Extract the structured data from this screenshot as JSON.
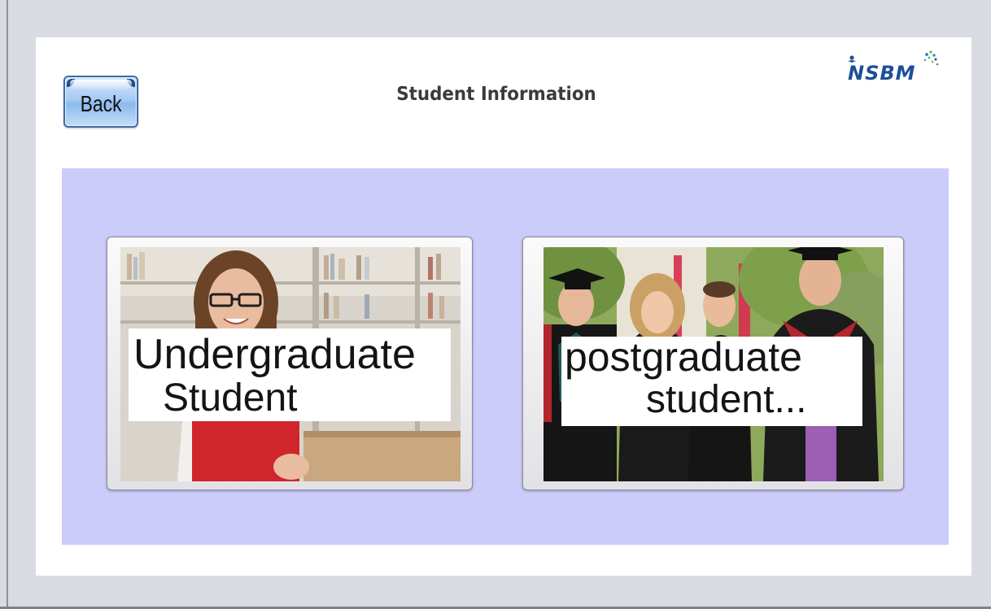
{
  "header": {
    "back_label": "Back",
    "title": "Student Information",
    "logo_text": "NSBM"
  },
  "tiles": [
    {
      "name": "undergraduate",
      "caption_line1": "Undergraduate",
      "caption_line2": "Student"
    },
    {
      "name": "postgraduate",
      "caption_line1": "postgraduate",
      "caption_line2": "student..."
    }
  ],
  "colors": {
    "background": "#d8dbe2",
    "window": "#ffffff",
    "panel": "#ccccfa",
    "title_text": "#3b3b3b",
    "logo": "#1c4f97",
    "button": "#a7cbf3"
  },
  "icons": [
    "nsbm-logo-icon",
    "undergraduate-photo",
    "postgraduate-photo"
  ]
}
